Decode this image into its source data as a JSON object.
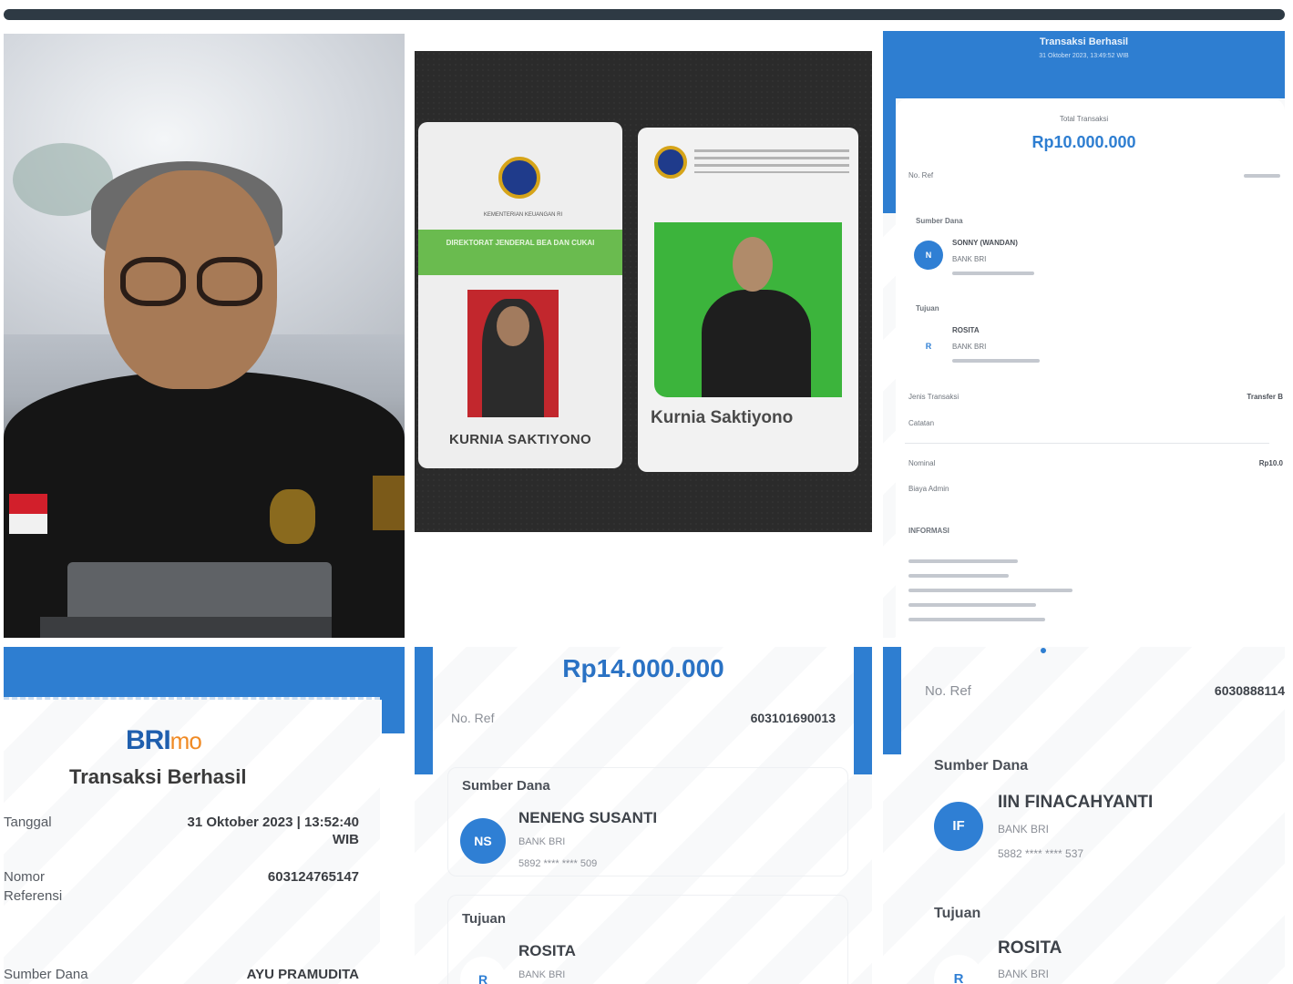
{
  "colors": {
    "brand_blue": "#2e7ed1",
    "brand_orange": "#f08a24",
    "card_green": "#6abb4f",
    "frame_dark": "#2e3a44"
  },
  "id_cards": {
    "card_front": {
      "ministry": "KEMENTERIAN KEUANGAN RI",
      "directorate": "DIREKTORAT JENDERAL BEA DAN CUKAI",
      "holder_name": "KURNIA SAKTIYONO"
    },
    "card_back": {
      "holder_name": "Kurnia Saktiyono"
    }
  },
  "receipt_top_right": {
    "header_title": "Transaksi Berhasil",
    "header_date": "31 Oktober 2023, 13:49:52 WIB",
    "total_label": "Total Transaksi",
    "amount": "Rp10.000.000",
    "ref_label": "No. Ref",
    "source_label": "Sumber Dana",
    "source_initials": "N",
    "source_name": "SONNY (WANDAN)",
    "source_bank": "BANK BRI",
    "destination_label": "Tujuan",
    "destination_initials": "R",
    "destination_name": "ROSITA",
    "destination_bank": "BANK BRI",
    "type_label": "Jenis Transaksi",
    "type_value": "Transfer B",
    "note_label": "Catatan",
    "nominal_label": "Nominal",
    "nominal_value": "Rp10.0",
    "fee_label": "Biaya Admin",
    "info_label": "INFORMASI"
  },
  "receipt_bottom_left": {
    "logo_bri": "BRI",
    "logo_mo": "mo",
    "title": "Transaksi Berhasil",
    "date_label": "Tanggal",
    "date_value": "31 Oktober 2023 | 13:52:40",
    "date_tz": "WIB",
    "ref_label_1": "Nomor",
    "ref_label_2": "Referensi",
    "ref_value": "603124765147",
    "source_label": "Sumber Dana",
    "source_value": "AYU PRAMUDITA"
  },
  "receipt_bottom_middle": {
    "amount": "Rp14.000.000",
    "ref_label": "No. Ref",
    "ref_value": "603101690013",
    "source_label": "Sumber Dana",
    "source_initials": "NS",
    "source_name": "NENENG SUSANTI",
    "source_bank": "BANK BRI",
    "source_account": "5892 **** **** 509",
    "destination_label": "Tujuan",
    "destination_initials": "R",
    "destination_name": "ROSITA",
    "destination_bank": "BANK BRI"
  },
  "receipt_bottom_right": {
    "ref_label": "No. Ref",
    "ref_value": "6030888114",
    "source_label": "Sumber Dana",
    "source_initials": "IF",
    "source_name": "IIN FINACAHYANTI",
    "source_bank": "BANK BRI",
    "source_account": "5882 **** **** 537",
    "destination_label": "Tujuan",
    "destination_initials": "R",
    "destination_name": "ROSITA",
    "destination_bank": "BANK BRI"
  }
}
